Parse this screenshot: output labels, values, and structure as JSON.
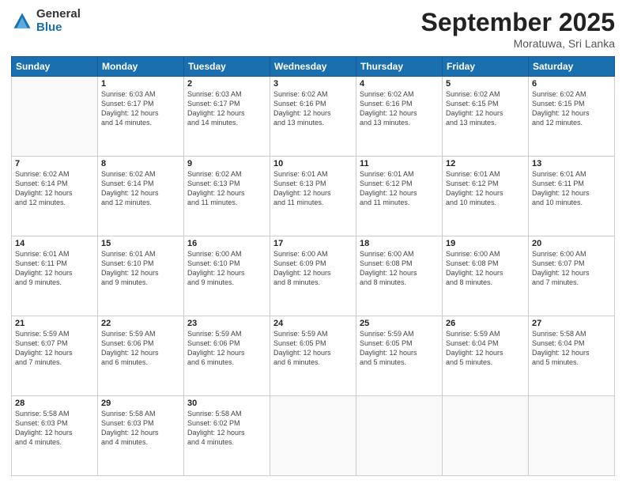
{
  "logo": {
    "general": "General",
    "blue": "Blue"
  },
  "title": {
    "month": "September 2025",
    "location": "Moratuwa, Sri Lanka"
  },
  "weekdays": [
    "Sunday",
    "Monday",
    "Tuesday",
    "Wednesday",
    "Thursday",
    "Friday",
    "Saturday"
  ],
  "weeks": [
    [
      {
        "day": "",
        "info": ""
      },
      {
        "day": "1",
        "info": "Sunrise: 6:03 AM\nSunset: 6:17 PM\nDaylight: 12 hours\nand 14 minutes."
      },
      {
        "day": "2",
        "info": "Sunrise: 6:03 AM\nSunset: 6:17 PM\nDaylight: 12 hours\nand 14 minutes."
      },
      {
        "day": "3",
        "info": "Sunrise: 6:02 AM\nSunset: 6:16 PM\nDaylight: 12 hours\nand 13 minutes."
      },
      {
        "day": "4",
        "info": "Sunrise: 6:02 AM\nSunset: 6:16 PM\nDaylight: 12 hours\nand 13 minutes."
      },
      {
        "day": "5",
        "info": "Sunrise: 6:02 AM\nSunset: 6:15 PM\nDaylight: 12 hours\nand 13 minutes."
      },
      {
        "day": "6",
        "info": "Sunrise: 6:02 AM\nSunset: 6:15 PM\nDaylight: 12 hours\nand 12 minutes."
      }
    ],
    [
      {
        "day": "7",
        "info": "Sunrise: 6:02 AM\nSunset: 6:14 PM\nDaylight: 12 hours\nand 12 minutes."
      },
      {
        "day": "8",
        "info": "Sunrise: 6:02 AM\nSunset: 6:14 PM\nDaylight: 12 hours\nand 12 minutes."
      },
      {
        "day": "9",
        "info": "Sunrise: 6:02 AM\nSunset: 6:13 PM\nDaylight: 12 hours\nand 11 minutes."
      },
      {
        "day": "10",
        "info": "Sunrise: 6:01 AM\nSunset: 6:13 PM\nDaylight: 12 hours\nand 11 minutes."
      },
      {
        "day": "11",
        "info": "Sunrise: 6:01 AM\nSunset: 6:12 PM\nDaylight: 12 hours\nand 11 minutes."
      },
      {
        "day": "12",
        "info": "Sunrise: 6:01 AM\nSunset: 6:12 PM\nDaylight: 12 hours\nand 10 minutes."
      },
      {
        "day": "13",
        "info": "Sunrise: 6:01 AM\nSunset: 6:11 PM\nDaylight: 12 hours\nand 10 minutes."
      }
    ],
    [
      {
        "day": "14",
        "info": "Sunrise: 6:01 AM\nSunset: 6:11 PM\nDaylight: 12 hours\nand 9 minutes."
      },
      {
        "day": "15",
        "info": "Sunrise: 6:01 AM\nSunset: 6:10 PM\nDaylight: 12 hours\nand 9 minutes."
      },
      {
        "day": "16",
        "info": "Sunrise: 6:00 AM\nSunset: 6:10 PM\nDaylight: 12 hours\nand 9 minutes."
      },
      {
        "day": "17",
        "info": "Sunrise: 6:00 AM\nSunset: 6:09 PM\nDaylight: 12 hours\nand 8 minutes."
      },
      {
        "day": "18",
        "info": "Sunrise: 6:00 AM\nSunset: 6:08 PM\nDaylight: 12 hours\nand 8 minutes."
      },
      {
        "day": "19",
        "info": "Sunrise: 6:00 AM\nSunset: 6:08 PM\nDaylight: 12 hours\nand 8 minutes."
      },
      {
        "day": "20",
        "info": "Sunrise: 6:00 AM\nSunset: 6:07 PM\nDaylight: 12 hours\nand 7 minutes."
      }
    ],
    [
      {
        "day": "21",
        "info": "Sunrise: 5:59 AM\nSunset: 6:07 PM\nDaylight: 12 hours\nand 7 minutes."
      },
      {
        "day": "22",
        "info": "Sunrise: 5:59 AM\nSunset: 6:06 PM\nDaylight: 12 hours\nand 6 minutes."
      },
      {
        "day": "23",
        "info": "Sunrise: 5:59 AM\nSunset: 6:06 PM\nDaylight: 12 hours\nand 6 minutes."
      },
      {
        "day": "24",
        "info": "Sunrise: 5:59 AM\nSunset: 6:05 PM\nDaylight: 12 hours\nand 6 minutes."
      },
      {
        "day": "25",
        "info": "Sunrise: 5:59 AM\nSunset: 6:05 PM\nDaylight: 12 hours\nand 5 minutes."
      },
      {
        "day": "26",
        "info": "Sunrise: 5:59 AM\nSunset: 6:04 PM\nDaylight: 12 hours\nand 5 minutes."
      },
      {
        "day": "27",
        "info": "Sunrise: 5:58 AM\nSunset: 6:04 PM\nDaylight: 12 hours\nand 5 minutes."
      }
    ],
    [
      {
        "day": "28",
        "info": "Sunrise: 5:58 AM\nSunset: 6:03 PM\nDaylight: 12 hours\nand 4 minutes."
      },
      {
        "day": "29",
        "info": "Sunrise: 5:58 AM\nSunset: 6:03 PM\nDaylight: 12 hours\nand 4 minutes."
      },
      {
        "day": "30",
        "info": "Sunrise: 5:58 AM\nSunset: 6:02 PM\nDaylight: 12 hours\nand 4 minutes."
      },
      {
        "day": "",
        "info": ""
      },
      {
        "day": "",
        "info": ""
      },
      {
        "day": "",
        "info": ""
      },
      {
        "day": "",
        "info": ""
      }
    ]
  ]
}
